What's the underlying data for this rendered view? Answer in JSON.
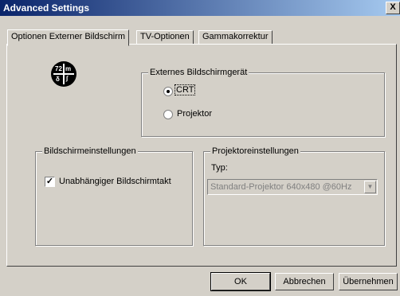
{
  "window": {
    "title": "Advanced Settings",
    "close_label": "X"
  },
  "tabs": [
    {
      "label": "Optionen Externer Bildschirm",
      "active": true
    },
    {
      "label": "TV-Optionen",
      "active": false
    },
    {
      "label": "Gammakorrektur",
      "active": false
    }
  ],
  "logo": {
    "icon": "display-driver-logo-icon",
    "glyphs": [
      "72",
      "m",
      "δ",
      "∫"
    ]
  },
  "external_display": {
    "title": "Externes Bildschirmgerät",
    "options": [
      {
        "label": "CRT",
        "selected": true
      },
      {
        "label": "Projektor",
        "selected": false
      }
    ]
  },
  "screen_settings": {
    "title": "Bildschirmeinstellungen",
    "checkbox_label": "Unabhängiger Bildschirmtakt",
    "checked": true
  },
  "projector_settings": {
    "title": "Projektoreinstellungen",
    "type_label": "Typ:",
    "type_value": "Standard-Projektor  640x480 @60Hz",
    "disabled": true
  },
  "buttons": {
    "ok": "OK",
    "cancel": "Abbrechen",
    "apply": "Übernehmen"
  }
}
